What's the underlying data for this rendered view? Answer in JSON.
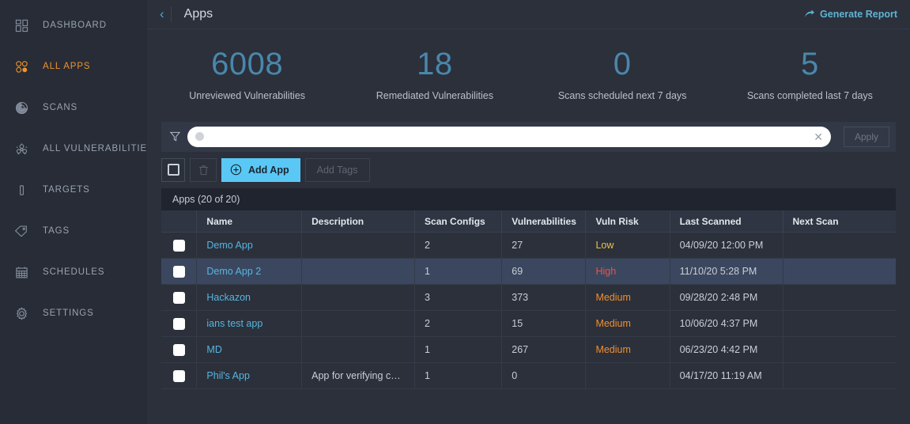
{
  "sidebar": {
    "items": [
      {
        "label": "DASHBOARD",
        "icon": "dashboard-grid-icon",
        "active": false,
        "key": "dashboard"
      },
      {
        "label": "ALL APPS",
        "icon": "apps-dots-icon",
        "active": true,
        "key": "all-apps"
      },
      {
        "label": "SCANS",
        "icon": "radar-scan-icon",
        "active": false,
        "key": "scans"
      },
      {
        "label": "ALL VULNERABILITIES",
        "icon": "biohazard-icon",
        "active": false,
        "key": "all-vulnerabilities"
      },
      {
        "label": "TARGETS",
        "icon": "target-icon",
        "active": false,
        "key": "targets"
      },
      {
        "label": "TAGS",
        "icon": "tag-icon",
        "active": false,
        "key": "tags"
      },
      {
        "label": "SCHEDULES",
        "icon": "calendar-icon",
        "active": false,
        "key": "schedules"
      },
      {
        "label": "SETTINGS",
        "icon": "gear-icon",
        "active": false,
        "key": "settings"
      }
    ],
    "active_color": "#f0932b",
    "background": "#272c36"
  },
  "topbar": {
    "back_label": "‹",
    "title": "Apps",
    "generate_report_label": "Generate Report",
    "link_color": "#5fb3d4"
  },
  "stats": [
    {
      "value": "6008",
      "label": "Unreviewed Vulnerabilities"
    },
    {
      "value": "18",
      "label": "Remediated Vulnerabilities"
    },
    {
      "value": "0",
      "label": "Scans scheduled next 7 days"
    },
    {
      "value": "5",
      "label": "Scans completed last 7 days"
    }
  ],
  "stat_value_color": "#4a87ab",
  "filterbar": {
    "filter_icon": "funnel-icon",
    "search_value": "",
    "search_placeholder": "",
    "clear_label": "✕",
    "apply_label": "Apply",
    "apply_enabled": false
  },
  "actionbar": {
    "select_all_label": "",
    "delete_label": "",
    "add_app_label": "Add App",
    "add_app_icon": "plus-circle-icon",
    "add_app_color": "#5ac8f5",
    "add_tags_label": "Add Tags",
    "add_tags_enabled": false
  },
  "table": {
    "caption": "Apps (20 of 20)",
    "columns": [
      "",
      "Name",
      "Description",
      "Scan Configs",
      "Vulnerabilities",
      "Vuln Risk",
      "Last Scanned",
      "Next Scan"
    ],
    "rows": [
      {
        "name": "Demo App",
        "description": "",
        "scan_configs": "2",
        "vulnerabilities": "27",
        "vuln_risk": "Low",
        "risk_level": "low",
        "last_scanned": "04/09/20 12:00 PM",
        "next_scan": "",
        "selected": false
      },
      {
        "name": "Demo App 2",
        "description": "",
        "scan_configs": "1",
        "vulnerabilities": "69",
        "vuln_risk": "High",
        "risk_level": "high",
        "last_scanned": "11/10/20 5:28 PM",
        "next_scan": "",
        "selected": true
      },
      {
        "name": "Hackazon",
        "description": "",
        "scan_configs": "3",
        "vulnerabilities": "373",
        "vuln_risk": "Medium",
        "risk_level": "medium",
        "last_scanned": "09/28/20 2:48 PM",
        "next_scan": "",
        "selected": false
      },
      {
        "name": "ians test app",
        "description": "",
        "scan_configs": "2",
        "vulnerabilities": "15",
        "vuln_risk": "Medium",
        "risk_level": "medium",
        "last_scanned": "10/06/20 4:37 PM",
        "next_scan": "",
        "selected": false
      },
      {
        "name": "MD",
        "description": "",
        "scan_configs": "1",
        "vulnerabilities": "267",
        "vuln_risk": "Medium",
        "risk_level": "medium",
        "last_scanned": "06/23/20 4:42 PM",
        "next_scan": "",
        "selected": false
      },
      {
        "name": "Phil's App",
        "description": "App for verifying c…",
        "scan_configs": "1",
        "vulnerabilities": "0",
        "vuln_risk": "",
        "risk_level": "none",
        "last_scanned": "04/17/20 11:19 AM",
        "next_scan": "",
        "selected": false
      }
    ]
  },
  "risk_colors": {
    "low": "#e8c547",
    "medium": "#ef8f32",
    "high": "#e8544a"
  }
}
